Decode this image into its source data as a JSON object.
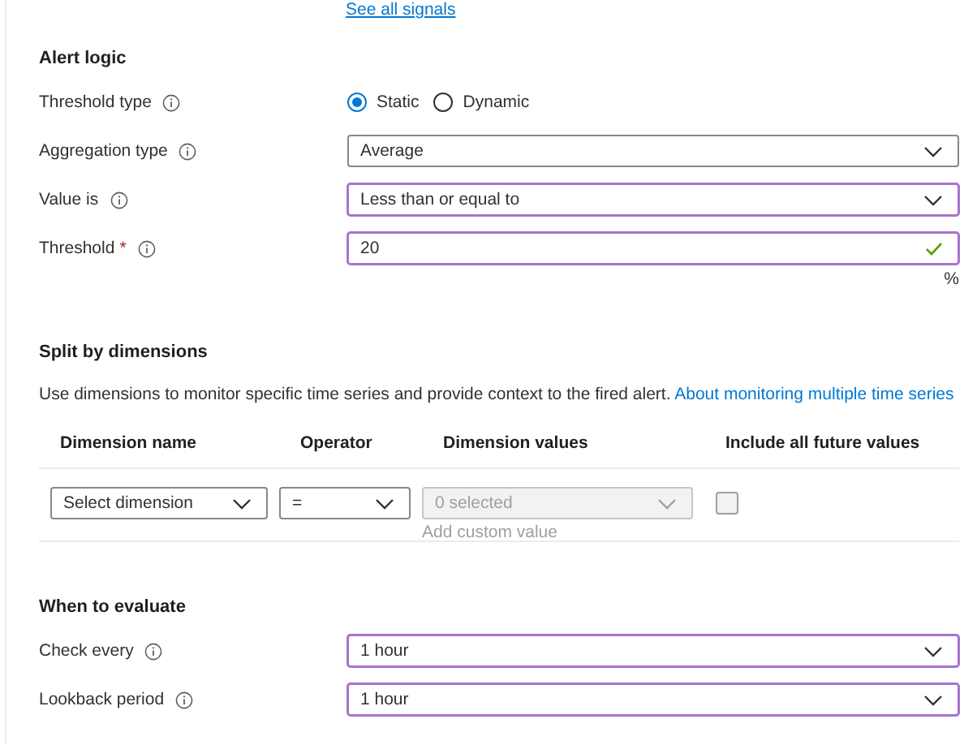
{
  "top_link": "See all signals",
  "alert_logic": {
    "heading": "Alert logic",
    "threshold_type": {
      "label": "Threshold type",
      "options": [
        {
          "label": "Static",
          "selected": true
        },
        {
          "label": "Dynamic",
          "selected": false
        }
      ]
    },
    "selects": [
      {
        "label": "Aggregation type",
        "value": "Average",
        "modified": false
      },
      {
        "label": "Value is",
        "value": "Less than or equal to",
        "modified": true
      }
    ],
    "threshold": {
      "label": "Threshold",
      "required_mark": "*",
      "value": "20",
      "valid": true,
      "modified": true,
      "unit": "%"
    }
  },
  "split": {
    "heading": "Split by dimensions",
    "description": "Use dimensions to monitor specific time series and provide context to the fired alert.",
    "link": "About monitoring multiple time series",
    "columns": [
      "Dimension name",
      "Operator",
      "Dimension values",
      "Include all future values"
    ],
    "rows": [
      {
        "dimension_name": {
          "placeholder": "Select dimension"
        },
        "operator": {
          "value": "="
        },
        "dimension_values": {
          "placeholder": "0 selected",
          "disabled": true
        },
        "add_custom_value": "Add custom value",
        "include_future": {
          "checked": false
        }
      }
    ]
  },
  "evaluate": {
    "heading": "When to evaluate",
    "fields": [
      {
        "label": "Check every",
        "value": "1 hour",
        "modified": true
      },
      {
        "label": "Lookback period",
        "value": "1 hour",
        "modified": true
      }
    ]
  }
}
